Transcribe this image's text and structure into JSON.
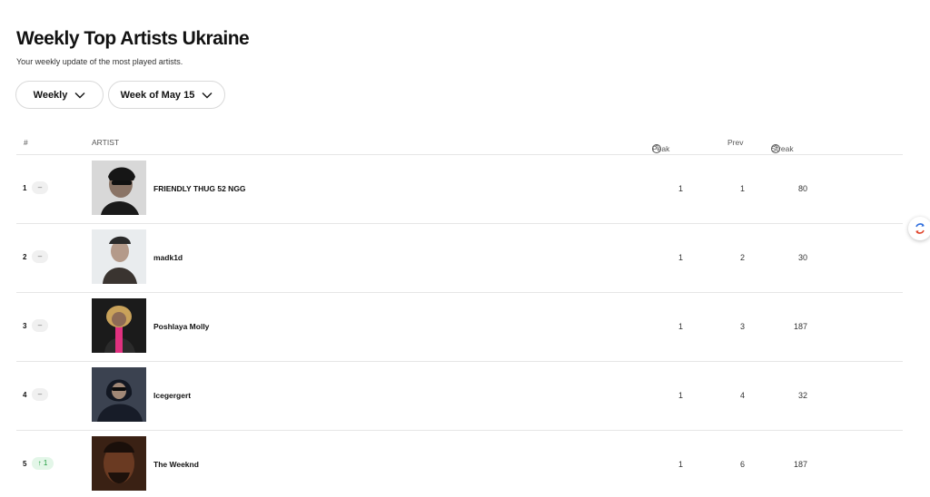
{
  "page": {
    "title": "Weekly Top Artists Ukraine",
    "subtitle": "Your weekly update of the most played artists."
  },
  "filters": {
    "period_label": "Weekly",
    "week_label": "Week of May 15"
  },
  "table": {
    "headers": {
      "rank": "#",
      "artist": "ARTIST",
      "peak": "Peak",
      "prev": "Prev",
      "streak": "Streak"
    },
    "rows": [
      {
        "rank": "1",
        "change": "–",
        "name": "FRIENDLY THUG 52 NGG",
        "peak": "1",
        "prev": "1",
        "streak": "80"
      },
      {
        "rank": "2",
        "change": "–",
        "name": "madk1d",
        "peak": "1",
        "prev": "2",
        "streak": "30"
      },
      {
        "rank": "3",
        "change": "–",
        "name": "Poshlaya Molly",
        "peak": "1",
        "prev": "3",
        "streak": "187"
      },
      {
        "rank": "4",
        "change": "–",
        "name": "Icegergert",
        "peak": "1",
        "prev": "4",
        "streak": "32"
      },
      {
        "rank": "5",
        "change": "↑ 1",
        "name": "The Weeknd",
        "peak": "1",
        "prev": "6",
        "streak": "187"
      }
    ]
  },
  "colors": {
    "accent_up": "#1a9b3a",
    "divider": "#e6e6e6"
  },
  "icons": {
    "chevron": "chevron-down-icon",
    "help": "help-circle-icon",
    "floating": "translate-icon"
  }
}
